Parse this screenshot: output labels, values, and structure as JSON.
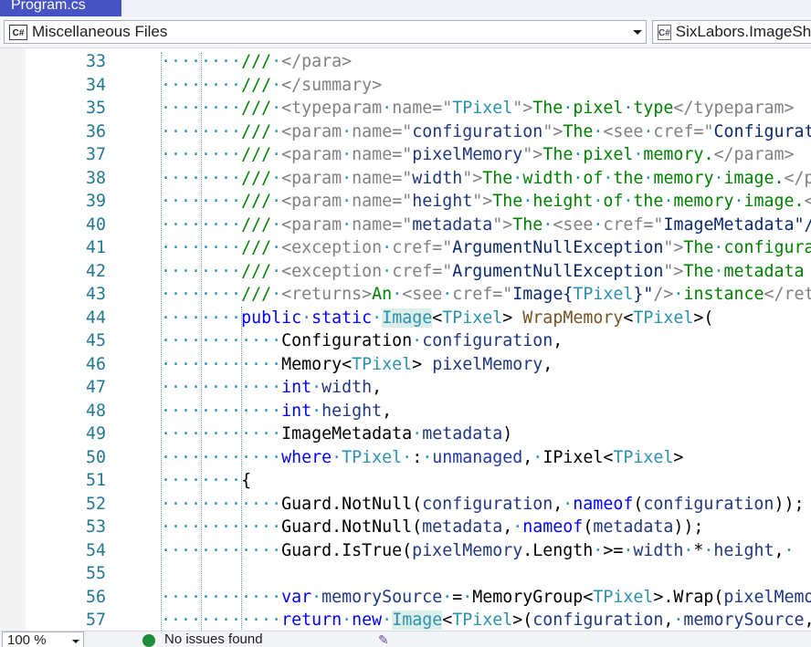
{
  "tab": {
    "title": "Program.cs"
  },
  "navbar": {
    "project_icon": "C#",
    "project": "Miscellaneous Files",
    "type_icon": "C#",
    "type": "SixLabors.ImageSharp.Image"
  },
  "code_lines": [
    {
      "n": "33",
      "indent": 8,
      "parts": [
        [
          "cm",
          "///"
        ],
        [
          "ws",
          "·"
        ],
        [
          "cmx",
          "</para>"
        ]
      ]
    },
    {
      "n": "34",
      "indent": 8,
      "parts": [
        [
          "cm",
          "///"
        ],
        [
          "ws",
          "·"
        ],
        [
          "cmx",
          "</summary>"
        ]
      ]
    },
    {
      "n": "35",
      "indent": 8,
      "parts": [
        [
          "cm",
          "///"
        ],
        [
          "ws",
          "·"
        ],
        [
          "cmx",
          "<typeparam"
        ],
        [
          "ws",
          "·"
        ],
        [
          "cmx",
          "name=\""
        ],
        [
          "ty",
          "TPixel"
        ],
        [
          "cmx",
          "\">"
        ],
        [
          "cm",
          "The"
        ],
        [
          "ws",
          "·"
        ],
        [
          "cm",
          "pixel"
        ],
        [
          "ws",
          "·"
        ],
        [
          "cm",
          "type"
        ],
        [
          "cmx",
          "</typeparam>"
        ]
      ]
    },
    {
      "n": "36",
      "indent": 8,
      "parts": [
        [
          "cm",
          "///"
        ],
        [
          "ws",
          "·"
        ],
        [
          "cmx",
          "<param"
        ],
        [
          "ws",
          "·"
        ],
        [
          "cmx",
          "name=\""
        ],
        [
          "par",
          "configuration"
        ],
        [
          "cmx",
          "\">"
        ],
        [
          "cm",
          "The"
        ],
        [
          "ws",
          "·"
        ],
        [
          "cmx",
          "<see"
        ],
        [
          "ws",
          "·"
        ],
        [
          "cmx",
          "cref=\""
        ],
        [
          "str",
          "Configuration\"/>"
        ]
      ]
    },
    {
      "n": "37",
      "indent": 8,
      "parts": [
        [
          "cm",
          "///"
        ],
        [
          "ws",
          "·"
        ],
        [
          "cmx",
          "<param"
        ],
        [
          "ws",
          "·"
        ],
        [
          "cmx",
          "name=\""
        ],
        [
          "par",
          "pixelMemory"
        ],
        [
          "cmx",
          "\">"
        ],
        [
          "cm",
          "The"
        ],
        [
          "ws",
          "·"
        ],
        [
          "cm",
          "pixel"
        ],
        [
          "ws",
          "·"
        ],
        [
          "cm",
          "memory."
        ],
        [
          "cmx",
          "</param>"
        ]
      ]
    },
    {
      "n": "38",
      "indent": 8,
      "parts": [
        [
          "cm",
          "///"
        ],
        [
          "ws",
          "·"
        ],
        [
          "cmx",
          "<param"
        ],
        [
          "ws",
          "·"
        ],
        [
          "cmx",
          "name=\""
        ],
        [
          "par",
          "width"
        ],
        [
          "cmx",
          "\">"
        ],
        [
          "cm",
          "The"
        ],
        [
          "ws",
          "·"
        ],
        [
          "cm",
          "width"
        ],
        [
          "ws",
          "·"
        ],
        [
          "cm",
          "of"
        ],
        [
          "ws",
          "·"
        ],
        [
          "cm",
          "the"
        ],
        [
          "ws",
          "·"
        ],
        [
          "cm",
          "memory"
        ],
        [
          "ws",
          "·"
        ],
        [
          "cm",
          "image."
        ],
        [
          "cmx",
          "</param>"
        ]
      ]
    },
    {
      "n": "39",
      "indent": 8,
      "parts": [
        [
          "cm",
          "///"
        ],
        [
          "ws",
          "·"
        ],
        [
          "cmx",
          "<param"
        ],
        [
          "ws",
          "·"
        ],
        [
          "cmx",
          "name=\""
        ],
        [
          "par",
          "height"
        ],
        [
          "cmx",
          "\">"
        ],
        [
          "cm",
          "The"
        ],
        [
          "ws",
          "·"
        ],
        [
          "cm",
          "height"
        ],
        [
          "ws",
          "·"
        ],
        [
          "cm",
          "of"
        ],
        [
          "ws",
          "·"
        ],
        [
          "cm",
          "the"
        ],
        [
          "ws",
          "·"
        ],
        [
          "cm",
          "memory"
        ],
        [
          "ws",
          "·"
        ],
        [
          "cm",
          "image."
        ],
        [
          "cmx",
          "</param>"
        ]
      ]
    },
    {
      "n": "40",
      "indent": 8,
      "parts": [
        [
          "cm",
          "///"
        ],
        [
          "ws",
          "·"
        ],
        [
          "cmx",
          "<param"
        ],
        [
          "ws",
          "·"
        ],
        [
          "cmx",
          "name=\""
        ],
        [
          "par",
          "metadata"
        ],
        [
          "cmx",
          "\">"
        ],
        [
          "cm",
          "The"
        ],
        [
          "ws",
          "·"
        ],
        [
          "cmx",
          "<see"
        ],
        [
          "ws",
          "·"
        ],
        [
          "cmx",
          "cref=\""
        ],
        [
          "str",
          "ImageMetadata\"/>"
        ]
      ]
    },
    {
      "n": "41",
      "indent": 8,
      "parts": [
        [
          "cm",
          "///"
        ],
        [
          "ws",
          "·"
        ],
        [
          "cmx",
          "<exception"
        ],
        [
          "ws",
          "·"
        ],
        [
          "cmx",
          "cref=\""
        ],
        [
          "str",
          "ArgumentNullException"
        ],
        [
          "cmx",
          "\">"
        ],
        [
          "cm",
          "The"
        ],
        [
          "ws",
          "·"
        ],
        [
          "cm",
          "configuration"
        ]
      ]
    },
    {
      "n": "42",
      "indent": 8,
      "parts": [
        [
          "cm",
          "///"
        ],
        [
          "ws",
          "·"
        ],
        [
          "cmx",
          "<exception"
        ],
        [
          "ws",
          "·"
        ],
        [
          "cmx",
          "cref=\""
        ],
        [
          "str",
          "ArgumentNullException"
        ],
        [
          "cmx",
          "\">"
        ],
        [
          "cm",
          "The"
        ],
        [
          "ws",
          "·"
        ],
        [
          "cm",
          "metadata"
        ]
      ]
    },
    {
      "n": "43",
      "indent": 8,
      "parts": [
        [
          "cm",
          "///"
        ],
        [
          "ws",
          "·"
        ],
        [
          "cmx",
          "<returns>"
        ],
        [
          "cm",
          "An"
        ],
        [
          "ws",
          "·"
        ],
        [
          "cmx",
          "<see"
        ],
        [
          "ws",
          "·"
        ],
        [
          "cmx",
          "cref=\""
        ],
        [
          "str",
          "Image{"
        ],
        [
          "ty",
          "TPixel"
        ],
        [
          "str",
          "}\""
        ],
        [
          "cmx",
          "/>"
        ],
        [
          "ws",
          "·"
        ],
        [
          "cm",
          "instance"
        ],
        [
          "cmx",
          "</returns>"
        ]
      ]
    },
    {
      "n": "44",
      "indent": 8,
      "parts": [
        [
          "kw",
          "public"
        ],
        [
          "ws",
          "·"
        ],
        [
          "kw",
          "static"
        ],
        [
          "ws",
          "·"
        ],
        [
          "tyhl",
          "Image"
        ],
        [
          "",
          "<"
        ],
        [
          "ty",
          "TPixel"
        ],
        [
          "",
          "> "
        ],
        [
          "fn",
          "WrapMemory"
        ],
        [
          "",
          "<"
        ],
        [
          "ty",
          "TPixel"
        ],
        [
          "",
          ">("
        ]
      ]
    },
    {
      "n": "45",
      "indent": 12,
      "parts": [
        [
          "",
          "Configuration"
        ],
        [
          "ws",
          "·"
        ],
        [
          "par",
          "configuration"
        ],
        [
          "",
          ","
        ]
      ]
    },
    {
      "n": "46",
      "indent": 12,
      "parts": [
        [
          "",
          "Memory<"
        ],
        [
          "ty",
          "TPixel"
        ],
        [
          "",
          "> "
        ],
        [
          "par",
          "pixelMemory"
        ],
        [
          "",
          ","
        ]
      ]
    },
    {
      "n": "47",
      "indent": 12,
      "parts": [
        [
          "kw",
          "int"
        ],
        [
          "ws",
          "·"
        ],
        [
          "par",
          "width"
        ],
        [
          "",
          ","
        ]
      ]
    },
    {
      "n": "48",
      "indent": 12,
      "parts": [
        [
          "kw",
          "int"
        ],
        [
          "ws",
          "·"
        ],
        [
          "par",
          "height"
        ],
        [
          "",
          ","
        ]
      ]
    },
    {
      "n": "49",
      "indent": 12,
      "parts": [
        [
          "",
          "ImageMetadata"
        ],
        [
          "ws",
          "·"
        ],
        [
          "par",
          "metadata"
        ],
        [
          "",
          ")"
        ]
      ]
    },
    {
      "n": "50",
      "indent": 12,
      "parts": [
        [
          "kw",
          "where"
        ],
        [
          "ws",
          "·"
        ],
        [
          "ty",
          "TPixel"
        ],
        [
          "ws",
          "·"
        ],
        [
          "",
          ":"
        ],
        [
          "ws",
          "·"
        ],
        [
          "kw2",
          "unmanaged"
        ],
        [
          "",
          ","
        ],
        [
          "ws",
          "·"
        ],
        [
          "",
          "IPixel<"
        ],
        [
          "ty",
          "TPixel"
        ],
        [
          "",
          ">"
        ]
      ]
    },
    {
      "n": "51",
      "indent": 8,
      "parts": [
        [
          "",
          "{"
        ]
      ]
    },
    {
      "n": "52",
      "indent": 12,
      "parts": [
        [
          "",
          "Guard.NotNull("
        ],
        [
          "par",
          "configuration"
        ],
        [
          "",
          ","
        ],
        [
          "ws",
          "·"
        ],
        [
          "kw",
          "nameof"
        ],
        [
          "",
          "("
        ],
        [
          "par",
          "configuration"
        ],
        [
          "",
          "));"
        ]
      ]
    },
    {
      "n": "53",
      "indent": 12,
      "parts": [
        [
          "",
          "Guard.NotNull("
        ],
        [
          "par",
          "metadata"
        ],
        [
          "",
          ","
        ],
        [
          "ws",
          "·"
        ],
        [
          "kw",
          "nameof"
        ],
        [
          "",
          "("
        ],
        [
          "par",
          "metadata"
        ],
        [
          "",
          "));"
        ]
      ]
    },
    {
      "n": "54",
      "indent": 12,
      "parts": [
        [
          "",
          "Guard.IsTrue("
        ],
        [
          "par",
          "pixelMemory"
        ],
        [
          "",
          ".Length"
        ],
        [
          "ws",
          "·"
        ],
        [
          "",
          ">="
        ],
        [
          "ws",
          "·"
        ],
        [
          "par",
          "width"
        ],
        [
          "ws",
          "·"
        ],
        [
          "",
          "*"
        ],
        [
          "ws",
          "·"
        ],
        [
          "par",
          "height"
        ],
        [
          "",
          ","
        ],
        [
          "ws",
          "·"
        ]
      ]
    },
    {
      "n": "55",
      "indent": 0,
      "parts": []
    },
    {
      "n": "56",
      "indent": 12,
      "parts": [
        [
          "kw",
          "var"
        ],
        [
          "ws",
          "·"
        ],
        [
          "par",
          "memorySource"
        ],
        [
          "ws",
          "·"
        ],
        [
          "",
          "="
        ],
        [
          "ws",
          "·"
        ],
        [
          "",
          "MemoryGroup<"
        ],
        [
          "ty",
          "TPixel"
        ],
        [
          "",
          ">.Wrap("
        ],
        [
          "par",
          "pixelMemory"
        ],
        [
          "",
          ");"
        ]
      ]
    },
    {
      "n": "57",
      "indent": 12,
      "parts": [
        [
          "kw",
          "return"
        ],
        [
          "ws",
          "·"
        ],
        [
          "kw",
          "new"
        ],
        [
          "ws",
          "·"
        ],
        [
          "tyhl",
          "Image"
        ],
        [
          "",
          "<"
        ],
        [
          "ty",
          "TPixel"
        ],
        [
          "",
          ">("
        ],
        [
          "par",
          "configuration"
        ],
        [
          "",
          ","
        ],
        [
          "ws",
          "·"
        ],
        [
          "par",
          "memorySource"
        ],
        [
          "",
          ","
        ]
      ]
    }
  ],
  "status": {
    "zoom": "100 %",
    "issues": "No issues found"
  },
  "colors": {
    "accent": "#4653c2",
    "line_number": "#237893",
    "keyword": "#0000ff",
    "type": "#2b91af",
    "comment": "#008000"
  }
}
